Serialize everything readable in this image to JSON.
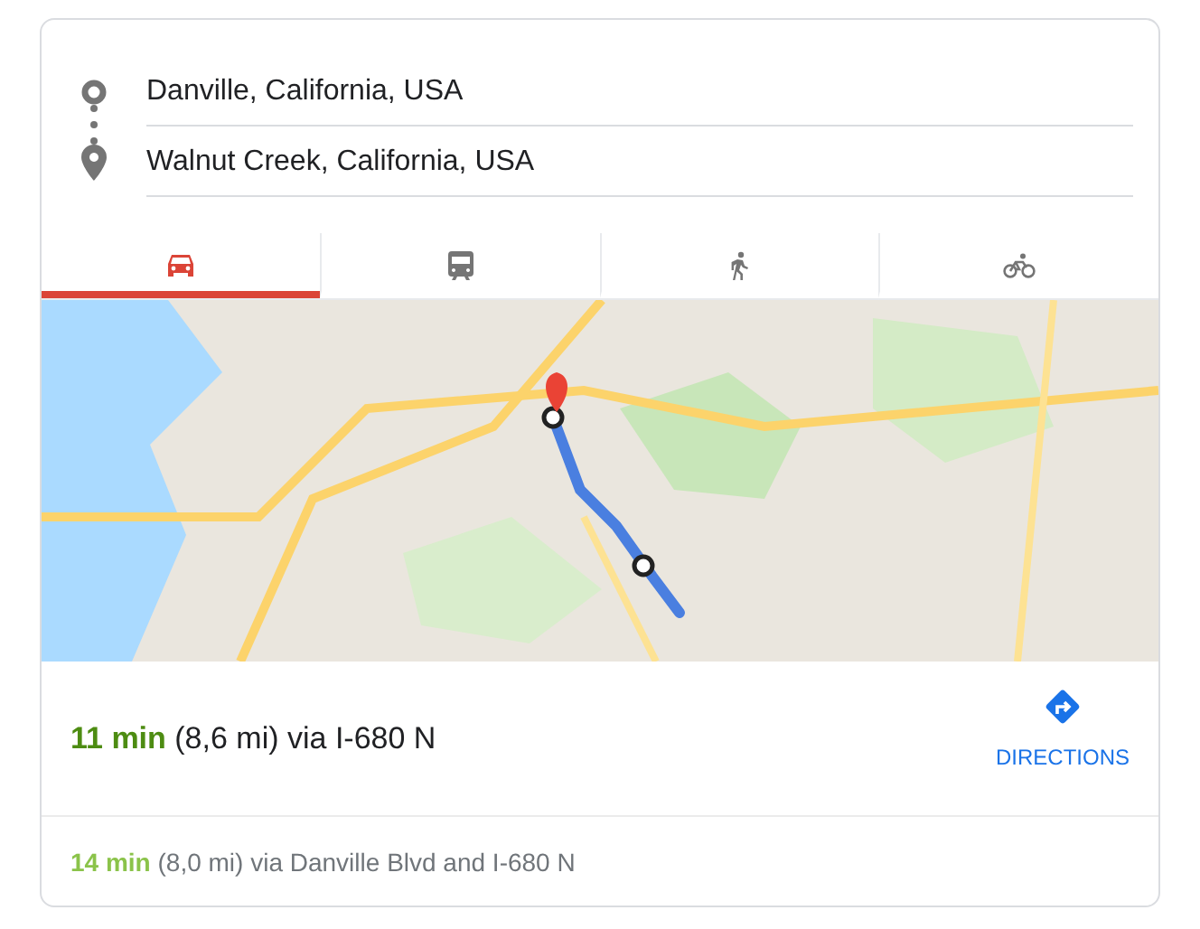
{
  "origin": {
    "value": "Danville, California, USA"
  },
  "destination": {
    "value": "Walnut Creek, California, USA"
  },
  "tabs": [
    {
      "kind": "car",
      "selected": true
    },
    {
      "kind": "transit",
      "selected": false
    },
    {
      "kind": "walk",
      "selected": false
    },
    {
      "kind": "bike",
      "selected": false
    }
  ],
  "routes": [
    {
      "kind": "primary",
      "text": "**11 min** (8,6 mi) via I-680 N"
    },
    {
      "kind": "alternative",
      "text": "**14 min** (8,0 mi) via Danville Blvd and I-680 N"
    }
  ],
  "directions_button": {
    "label": "DIRECTIONS"
  }
}
